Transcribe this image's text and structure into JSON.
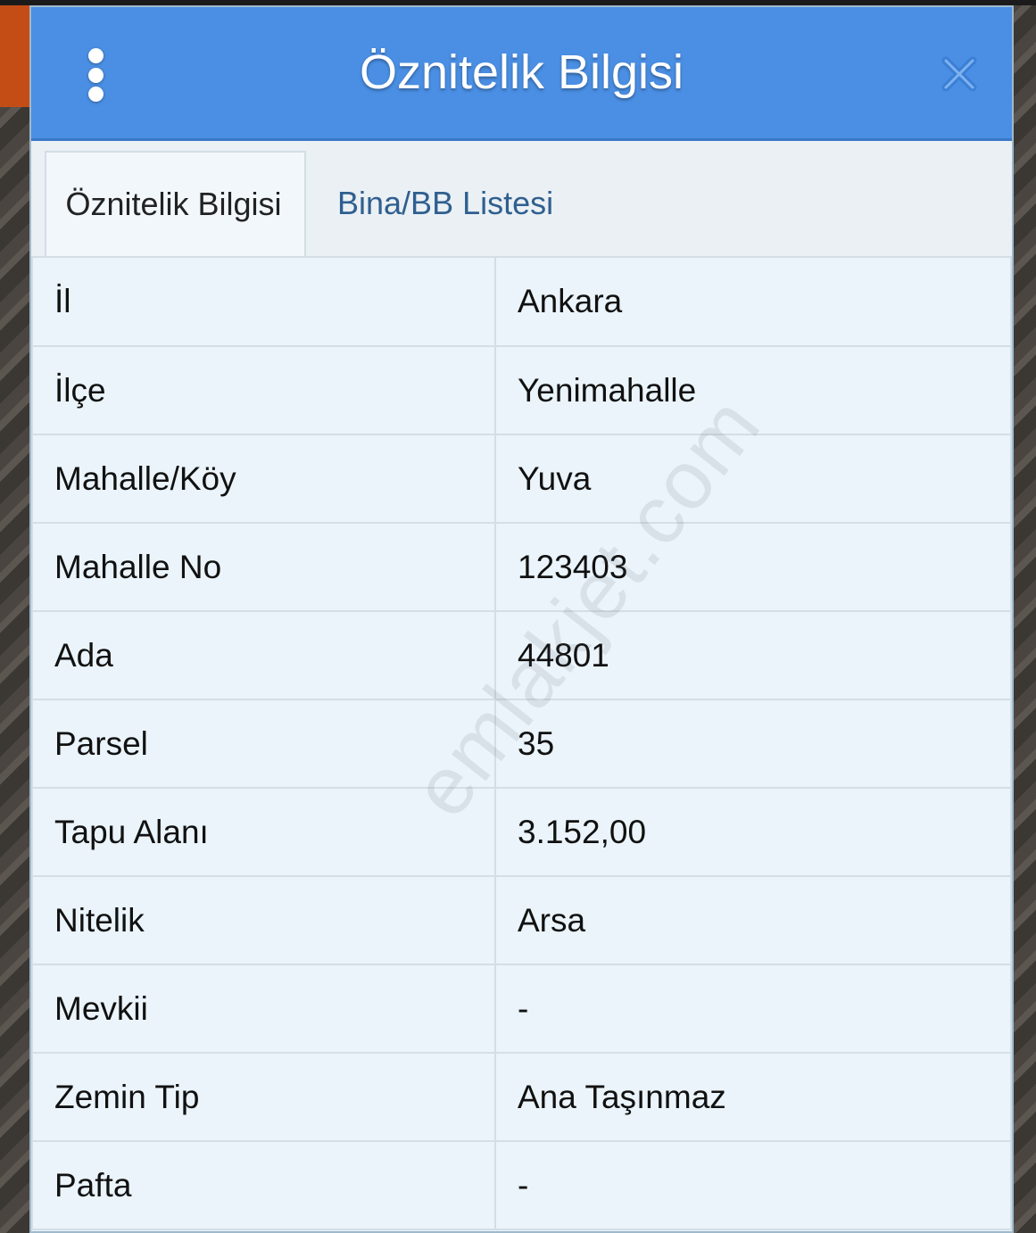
{
  "header": {
    "title": "Öznitelik Bilgisi",
    "menu_icon": "vertical-dots-icon",
    "close_icon": "close-icon",
    "close_color": "#3b7fd6"
  },
  "tabs": [
    {
      "label": "Öznitelik Bilgisi",
      "active": true
    },
    {
      "label": "Bina/BB Listesi",
      "active": false
    }
  ],
  "attributes": [
    {
      "key": "İl",
      "value": "Ankara"
    },
    {
      "key": "İlçe",
      "value": "Yenimahalle"
    },
    {
      "key": "Mahalle/Köy",
      "value": "Yuva"
    },
    {
      "key": "Mahalle No",
      "value": "123403"
    },
    {
      "key": "Ada",
      "value": "44801"
    },
    {
      "key": "Parsel",
      "value": "35"
    },
    {
      "key": "Tapu Alanı",
      "value": "3.152,00"
    },
    {
      "key": "Nitelik",
      "value": "Arsa"
    },
    {
      "key": "Mevkii",
      "value": "-"
    },
    {
      "key": "Zemin Tip",
      "value": "Ana Taşınmaz"
    },
    {
      "key": "Pafta",
      "value": "-"
    }
  ],
  "watermark": "emlakjet.com",
  "colors": {
    "header_bg": "#4a8fe4",
    "panel_bg": "#e8f2f8",
    "inactive_tab_text": "#2f5f8f"
  }
}
